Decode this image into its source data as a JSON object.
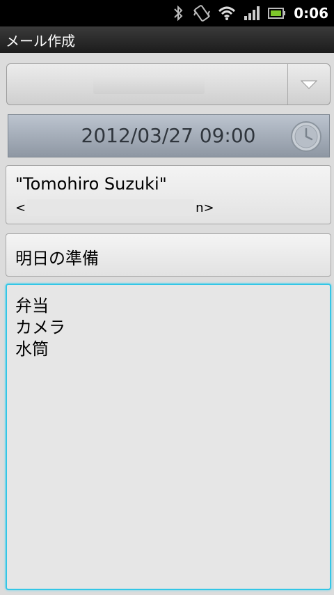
{
  "status_bar": {
    "time": "0:06",
    "icons": [
      "bluetooth-icon",
      "vibrate-icon",
      "wifi-icon",
      "signal-icon",
      "battery-icon"
    ]
  },
  "title_bar": {
    "title": "メール作成"
  },
  "account_spinner": {
    "selected": "",
    "icon": "dropdown-arrow-icon"
  },
  "schedule": {
    "datetime": "2012/03/27  09:00",
    "icon": "clock-icon"
  },
  "to": {
    "name": "\"Tomohiro Suzuki\"",
    "addr_open": "<",
    "addr_close": "n>"
  },
  "subject": {
    "value": "明日の準備"
  },
  "body": {
    "lines": [
      "弁当",
      "カメラ",
      "水筒"
    ]
  },
  "colors": {
    "focus_border": "#33c6e6",
    "battery": "#7ec62b"
  }
}
